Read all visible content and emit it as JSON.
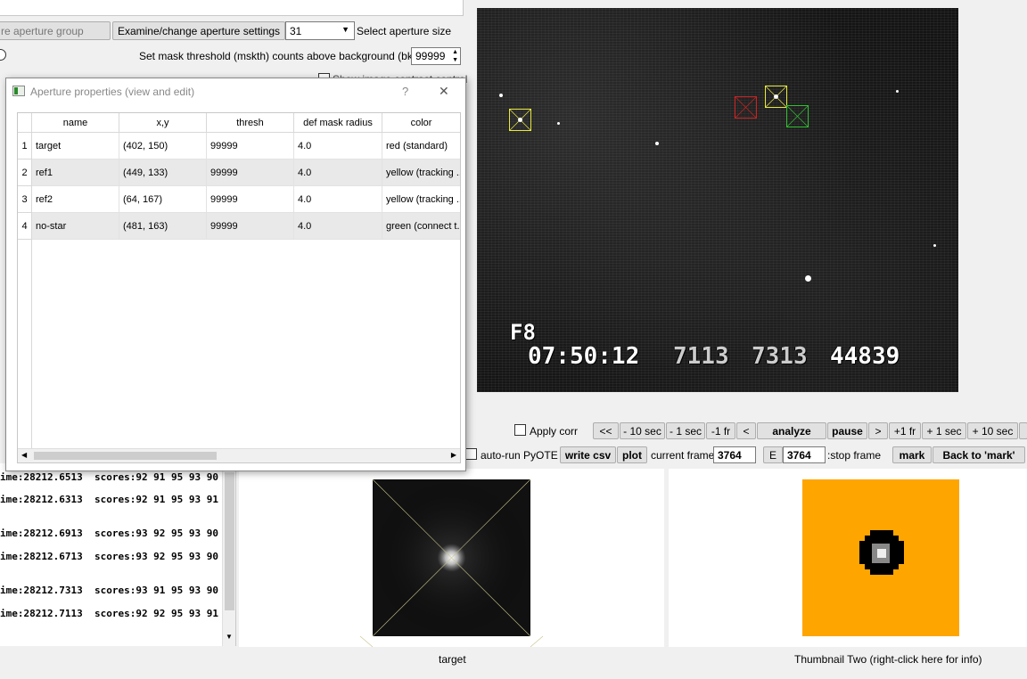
{
  "top_controls": {
    "aperture_group_btn": "re aperture group",
    "examine_btn": "Examine/change aperture settings",
    "aperture_size_value": "31",
    "aperture_size_label": "Select aperture size",
    "mask_label": "Set mask threshold (mskth) counts above background (bkavg)",
    "mask_value": "99999",
    "show_image_contrast": "Show image contrast control"
  },
  "dialog": {
    "title": "Aperture properties (view and edit)",
    "help_glyph": "?",
    "close_glyph": "✕",
    "columns": [
      "name",
      "x,y",
      "thresh",
      "def mask radius",
      "color"
    ],
    "rows": [
      {
        "idx": "1",
        "name": "target",
        "xy": "(402, 150)",
        "thresh": "99999",
        "radius": "4.0",
        "color": "red (standard)"
      },
      {
        "idx": "2",
        "name": "ref1",
        "xy": "(449, 133)",
        "thresh": "99999",
        "radius": "4.0",
        "color": "yellow (tracking ..."
      },
      {
        "idx": "3",
        "name": "ref2",
        "xy": "(64, 167)",
        "thresh": "99999",
        "radius": "4.0",
        "color": "yellow (tracking ..."
      },
      {
        "idx": "4",
        "name": "no-star",
        "xy": "(481, 163)",
        "thresh": "99999",
        "radius": "4.0",
        "color": "green (connect t..."
      }
    ]
  },
  "video": {
    "osd_line1": "F8",
    "osd_time": "07:50:12",
    "osd_n1": "7113",
    "osd_n2": "7313",
    "osd_n3": "44839"
  },
  "playback": {
    "apply_corr": "Apply corr",
    "rewind_all": "<<",
    "minus_10_sec": "- 10 sec",
    "minus_1_sec": "- 1 sec",
    "minus_1_fr": "-1 fr",
    "step_back": "<",
    "analyze": "analyze",
    "pause": "pause",
    "step_fwd": ">",
    "plus_1_fr": "+1 fr",
    "plus_1_sec": "+ 1 sec",
    "plus_10_sec": "+ 10 sec",
    "auto_run_pyote": "auto-run PyOTE",
    "write_csv": "write csv",
    "plot": "plot",
    "current_frame_label": "current frame:",
    "current_frame_value": "3764",
    "e_label": "E",
    "stop_frame_value": "3764",
    "stop_frame_label": ":stop frame",
    "mark": "mark",
    "back_to_mark": "Back to 'mark'"
  },
  "log_lines": [
    "ime:28212.6513  scores:92 91 95 93 90",
    "ime:28212.6313  scores:92 91 95 93 91",
    "ime:28212.6913  scores:93 92 95 93 90",
    "ime:28212.6713  scores:93 92 95 93 90",
    "ime:28212.7313  scores:93 91 95 93 90",
    "ime:28212.7113  scores:92 92 95 93 91"
  ],
  "thumbnails": {
    "one_label": "target",
    "two_label": "Thumbnail Two (right-click here for info)"
  },
  "colors": {
    "aperture_red": "#d02020",
    "aperture_yellow": "#e8e840",
    "aperture_green": "#30c030",
    "thumb_two_bg": "#ffa500"
  }
}
